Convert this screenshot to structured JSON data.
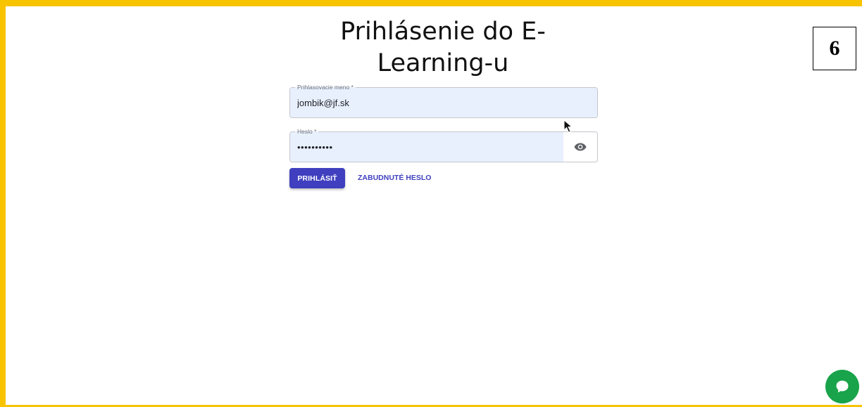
{
  "login": {
    "title": "Prihlásenie do E-Learning-u",
    "username": {
      "label": "Prihlasovacie meno *",
      "value": "jombik@jf.sk"
    },
    "password": {
      "label": "Heslo *",
      "value": "••••••••••"
    },
    "submit_label": "PRIHLÁSIŤ",
    "forgot_label": "ZABUDNUTÉ HESLO"
  },
  "step_badge": "6",
  "icons": {
    "password_toggle": "eye-icon",
    "chat": "chat-bubble-icon",
    "cursor": "mouse-pointer-icon"
  },
  "colors": {
    "frame": "#f8c400",
    "primary": "#3f3fbf",
    "autofill": "#e8f0fe",
    "chat": "#19a34a"
  }
}
